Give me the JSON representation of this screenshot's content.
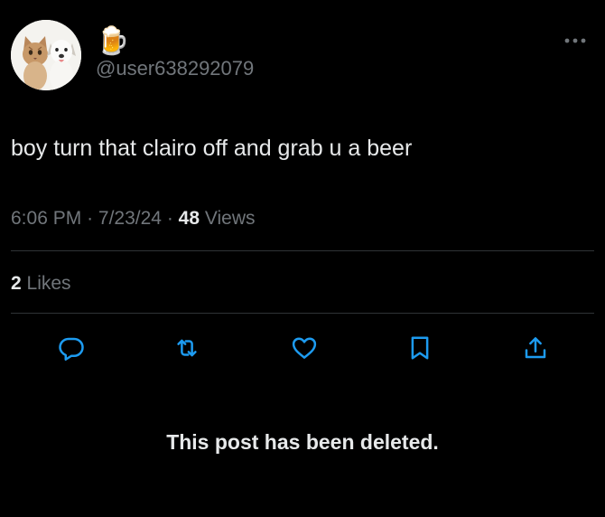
{
  "author": {
    "display_name": "🍺",
    "handle": "@user638292079",
    "avatar": "cat-and-dog-photo"
  },
  "more_icon": "ellipsis-icon",
  "tweet": {
    "text": "boy turn that clairo off and grab u a beer"
  },
  "meta": {
    "time": "6:06 PM",
    "separator": "·",
    "date": "7/23/24",
    "views_count": "48",
    "views_label": "Views"
  },
  "engagement": {
    "likes_count": "2",
    "likes_label": "Likes"
  },
  "actions": [
    {
      "name": "reply",
      "icon": "speech-bubble-icon"
    },
    {
      "name": "repost",
      "icon": "retweet-icon"
    },
    {
      "name": "like",
      "icon": "heart-icon"
    },
    {
      "name": "bookmark",
      "icon": "bookmark-icon"
    },
    {
      "name": "share",
      "icon": "share-upload-icon"
    }
  ],
  "notice": {
    "text": "This post has been deleted."
  },
  "colors": {
    "background": "#000000",
    "text_primary": "#e7e9ea",
    "text_secondary": "#71767b",
    "divider": "#2f3336"
  }
}
